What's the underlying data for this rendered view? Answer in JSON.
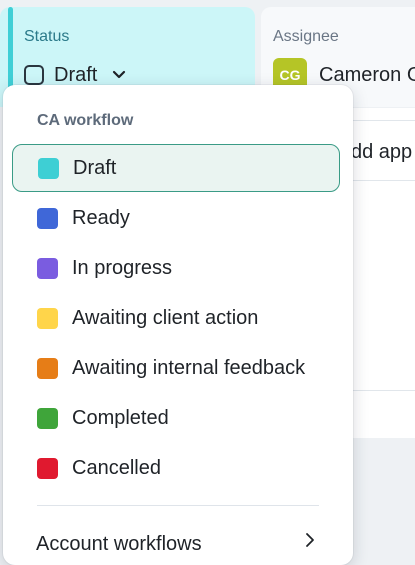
{
  "status_field": {
    "label": "Status",
    "value": "Draft"
  },
  "assignee_field": {
    "label": "Assignee",
    "initials": "CG",
    "name": "Cameron G",
    "avatar_color": "#b5c526"
  },
  "background": {
    "partial_text": "dd app"
  },
  "dropdown": {
    "heading": "CA workflow",
    "options": [
      {
        "label": "Draft",
        "color": "#3ecfd4",
        "selected": true
      },
      {
        "label": "Ready",
        "color": "#3f67d8"
      },
      {
        "label": "In progress",
        "color": "#7a5ce0"
      },
      {
        "label": "Awaiting client action",
        "color": "#ffd54a"
      },
      {
        "label": "Awaiting internal feedback",
        "color": "#e67d17"
      },
      {
        "label": "Completed",
        "color": "#3fa53a"
      },
      {
        "label": "Cancelled",
        "color": "#e0192f"
      }
    ],
    "footer": {
      "label": "Account workflows"
    }
  },
  "colors": {
    "status_bg": "#ccf6f8",
    "status_accent": "#3fcfd6",
    "selected_bg": "#eaf4f1",
    "selected_border": "#3a9b86"
  }
}
